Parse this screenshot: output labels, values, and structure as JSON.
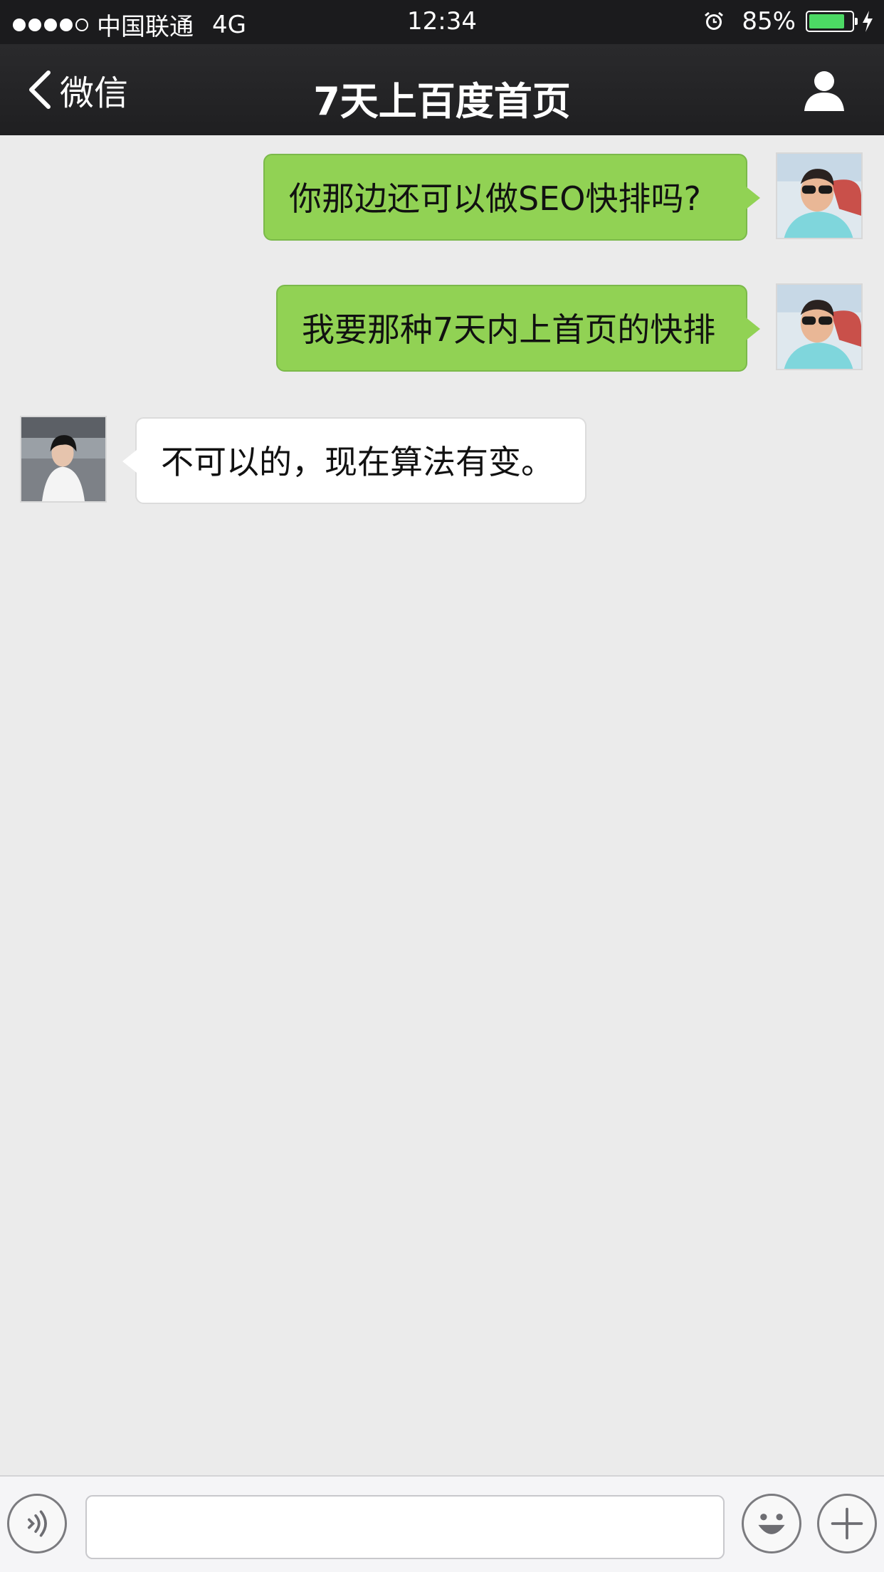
{
  "status_bar": {
    "carrier": "中国联通",
    "network": "4G",
    "time": "12:34",
    "battery_percent": "85%",
    "battery_level": 0.85,
    "signal_bars_filled": 4,
    "signal_bars_total": 5
  },
  "nav": {
    "back_label": "微信",
    "title": "7天上百度首页",
    "icons": {
      "back": "chevron-left-icon",
      "profile": "person-icon"
    }
  },
  "messages": [
    {
      "sender": "me",
      "text": "你那边还可以做SEO快排吗?"
    },
    {
      "sender": "me",
      "text": "我要那种7天内上首页的快排"
    },
    {
      "sender": "other",
      "text": "不可以的，现在算法有变。"
    }
  ],
  "input_bar": {
    "placeholder": "",
    "icons": {
      "voice": "voice-icon",
      "emoji": "emoji-icon",
      "more": "plus-icon"
    }
  },
  "colors": {
    "sent_bubble": "#91d254",
    "received_bubble": "#ffffff",
    "chat_background": "#ebebeb",
    "battery_fill": "#4cd964",
    "nav_background": "#1f1f21"
  }
}
